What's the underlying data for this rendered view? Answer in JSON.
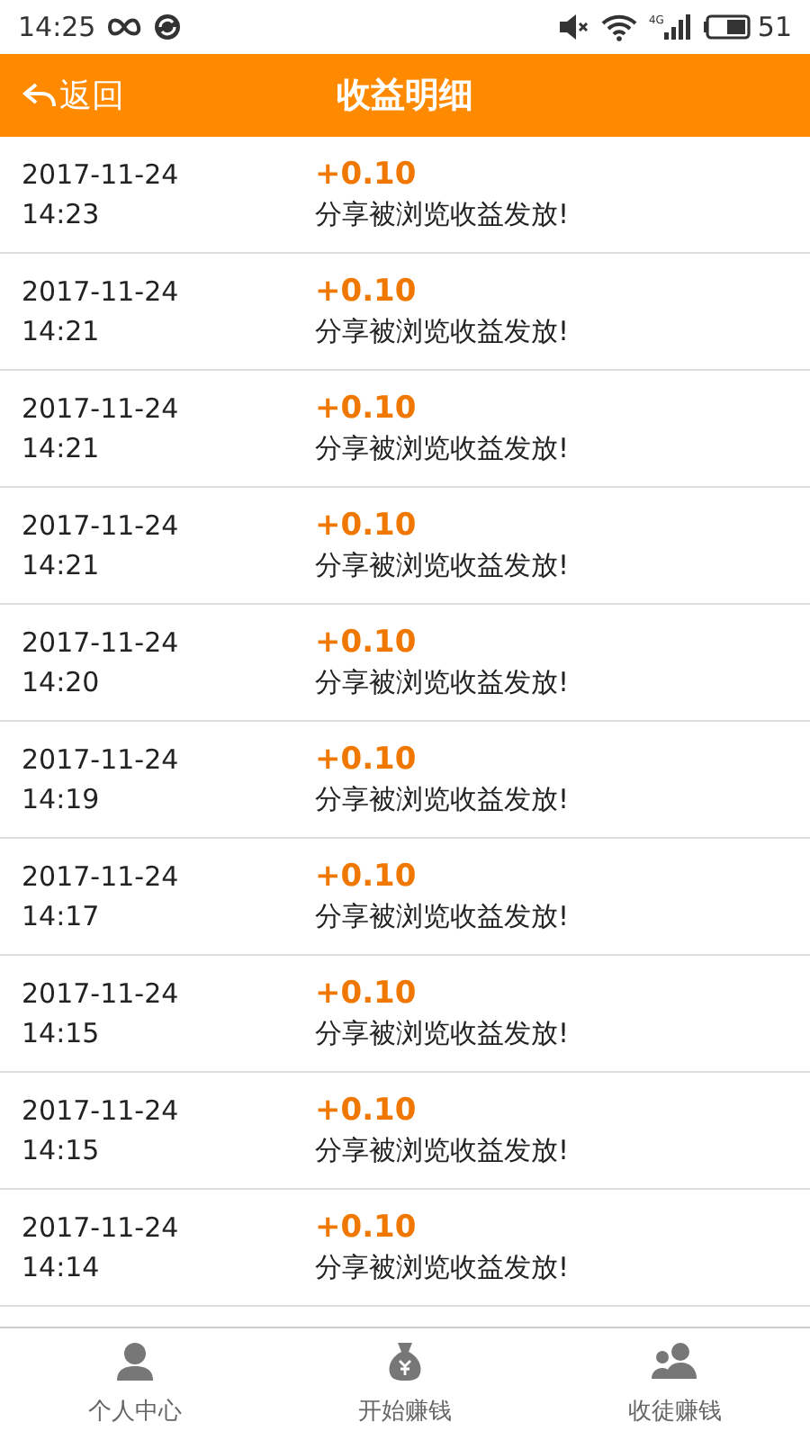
{
  "status_bar": {
    "time": "14:25",
    "network": "4G",
    "battery": "51"
  },
  "header": {
    "back": "返回",
    "title": "收益明细"
  },
  "records": [
    {
      "date": "2017-11-24",
      "time": "14:23",
      "amount": "+0.10",
      "description": "分享被浏览收益发放!"
    },
    {
      "date": "2017-11-24",
      "time": "14:21",
      "amount": "+0.10",
      "description": "分享被浏览收益发放!"
    },
    {
      "date": "2017-11-24",
      "time": "14:21",
      "amount": "+0.10",
      "description": "分享被浏览收益发放!"
    },
    {
      "date": "2017-11-24",
      "time": "14:21",
      "amount": "+0.10",
      "description": "分享被浏览收益发放!"
    },
    {
      "date": "2017-11-24",
      "time": "14:20",
      "amount": "+0.10",
      "description": "分享被浏览收益发放!"
    },
    {
      "date": "2017-11-24",
      "time": "14:19",
      "amount": "+0.10",
      "description": "分享被浏览收益发放!"
    },
    {
      "date": "2017-11-24",
      "time": "14:17",
      "amount": "+0.10",
      "description": "分享被浏览收益发放!"
    },
    {
      "date": "2017-11-24",
      "time": "14:15",
      "amount": "+0.10",
      "description": "分享被浏览收益发放!"
    },
    {
      "date": "2017-11-24",
      "time": "14:15",
      "amount": "+0.10",
      "description": "分享被浏览收益发放!"
    },
    {
      "date": "2017-11-24",
      "time": "14:14",
      "amount": "+0.10",
      "description": "分享被浏览收益发放!"
    }
  ],
  "tab_bar": [
    {
      "kind": "person",
      "label": "个人中心"
    },
    {
      "kind": "money",
      "label": "开始赚钱"
    },
    {
      "kind": "group",
      "label": "收徒赚钱"
    }
  ]
}
